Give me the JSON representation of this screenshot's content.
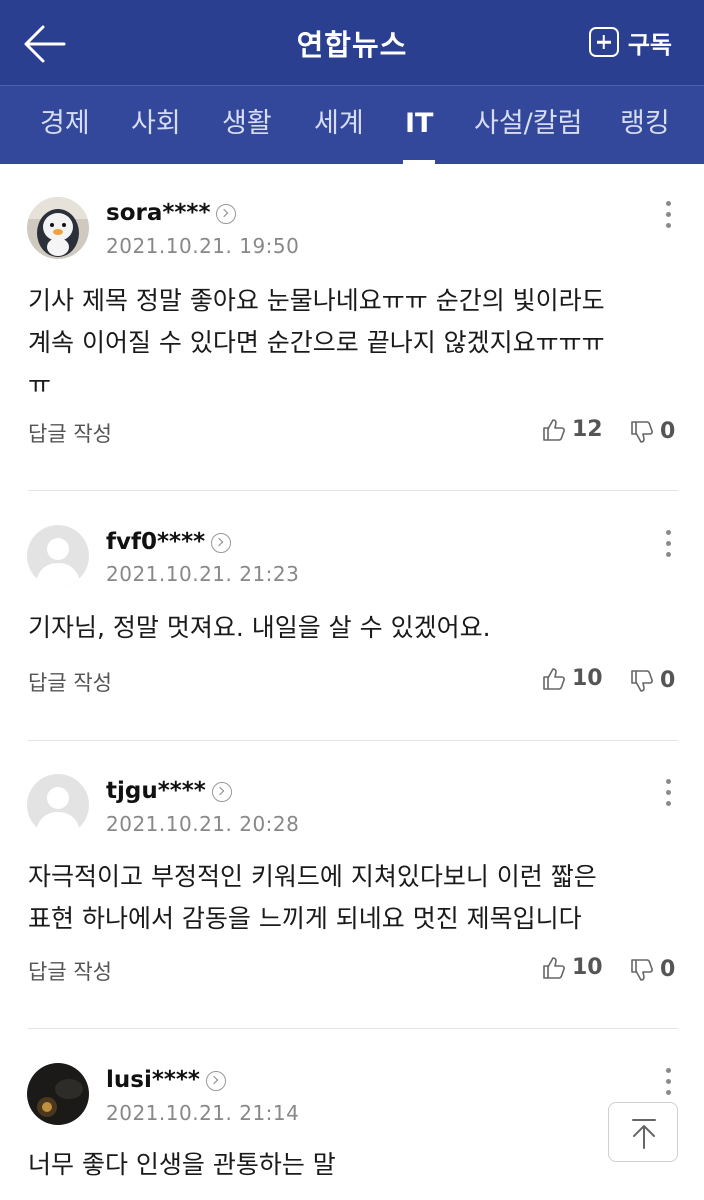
{
  "header": {
    "title": "연합뉴스",
    "subscribe_label": "구독"
  },
  "tabs": [
    {
      "label": "경제"
    },
    {
      "label": "사회"
    },
    {
      "label": "생활"
    },
    {
      "label": "세계"
    },
    {
      "label": "IT"
    },
    {
      "label": "사설/칼럼"
    },
    {
      "label": "랭킹"
    }
  ],
  "active_tab": "IT",
  "comments": [
    {
      "user": "sora****",
      "time": "2021.10.21. 19:50",
      "text_lines": [
        "기사 제목 정말 좋아요 눈물나네요ㅠㅠ 순간의 빛이라도",
        "계속 이어질 수 있다면 순간으로 끝나지 않겠지요ㅠㅠㅠ",
        "ㅠ"
      ],
      "reply_label": "답글 작성",
      "likes": "12",
      "dislikes": "0"
    },
    {
      "user": "fvf0****",
      "time": "2021.10.21. 21:23",
      "text_lines": [
        "기자님, 정말 멋져요. 내일을 살 수 있겠어요."
      ],
      "reply_label": "답글 작성",
      "likes": "10",
      "dislikes": "0"
    },
    {
      "user": "tjgu****",
      "time": "2021.10.21. 20:28",
      "text_lines": [
        "자극적이고 부정적인 키워드에 지쳐있다보니 이런 짧은",
        "표현 하나에서 감동을 느끼게 되네요 멋진 제목입니다"
      ],
      "reply_label": "답글 작성",
      "likes": "10",
      "dislikes": "0"
    },
    {
      "user": "lusi****",
      "time": "2021.10.21. 21:14",
      "text_lines": [
        "너무 좋다 인생을 관통하는 말"
      ]
    }
  ],
  "colors": {
    "header_bg": "#2a3f8f",
    "tab_bg": "#33489a"
  }
}
